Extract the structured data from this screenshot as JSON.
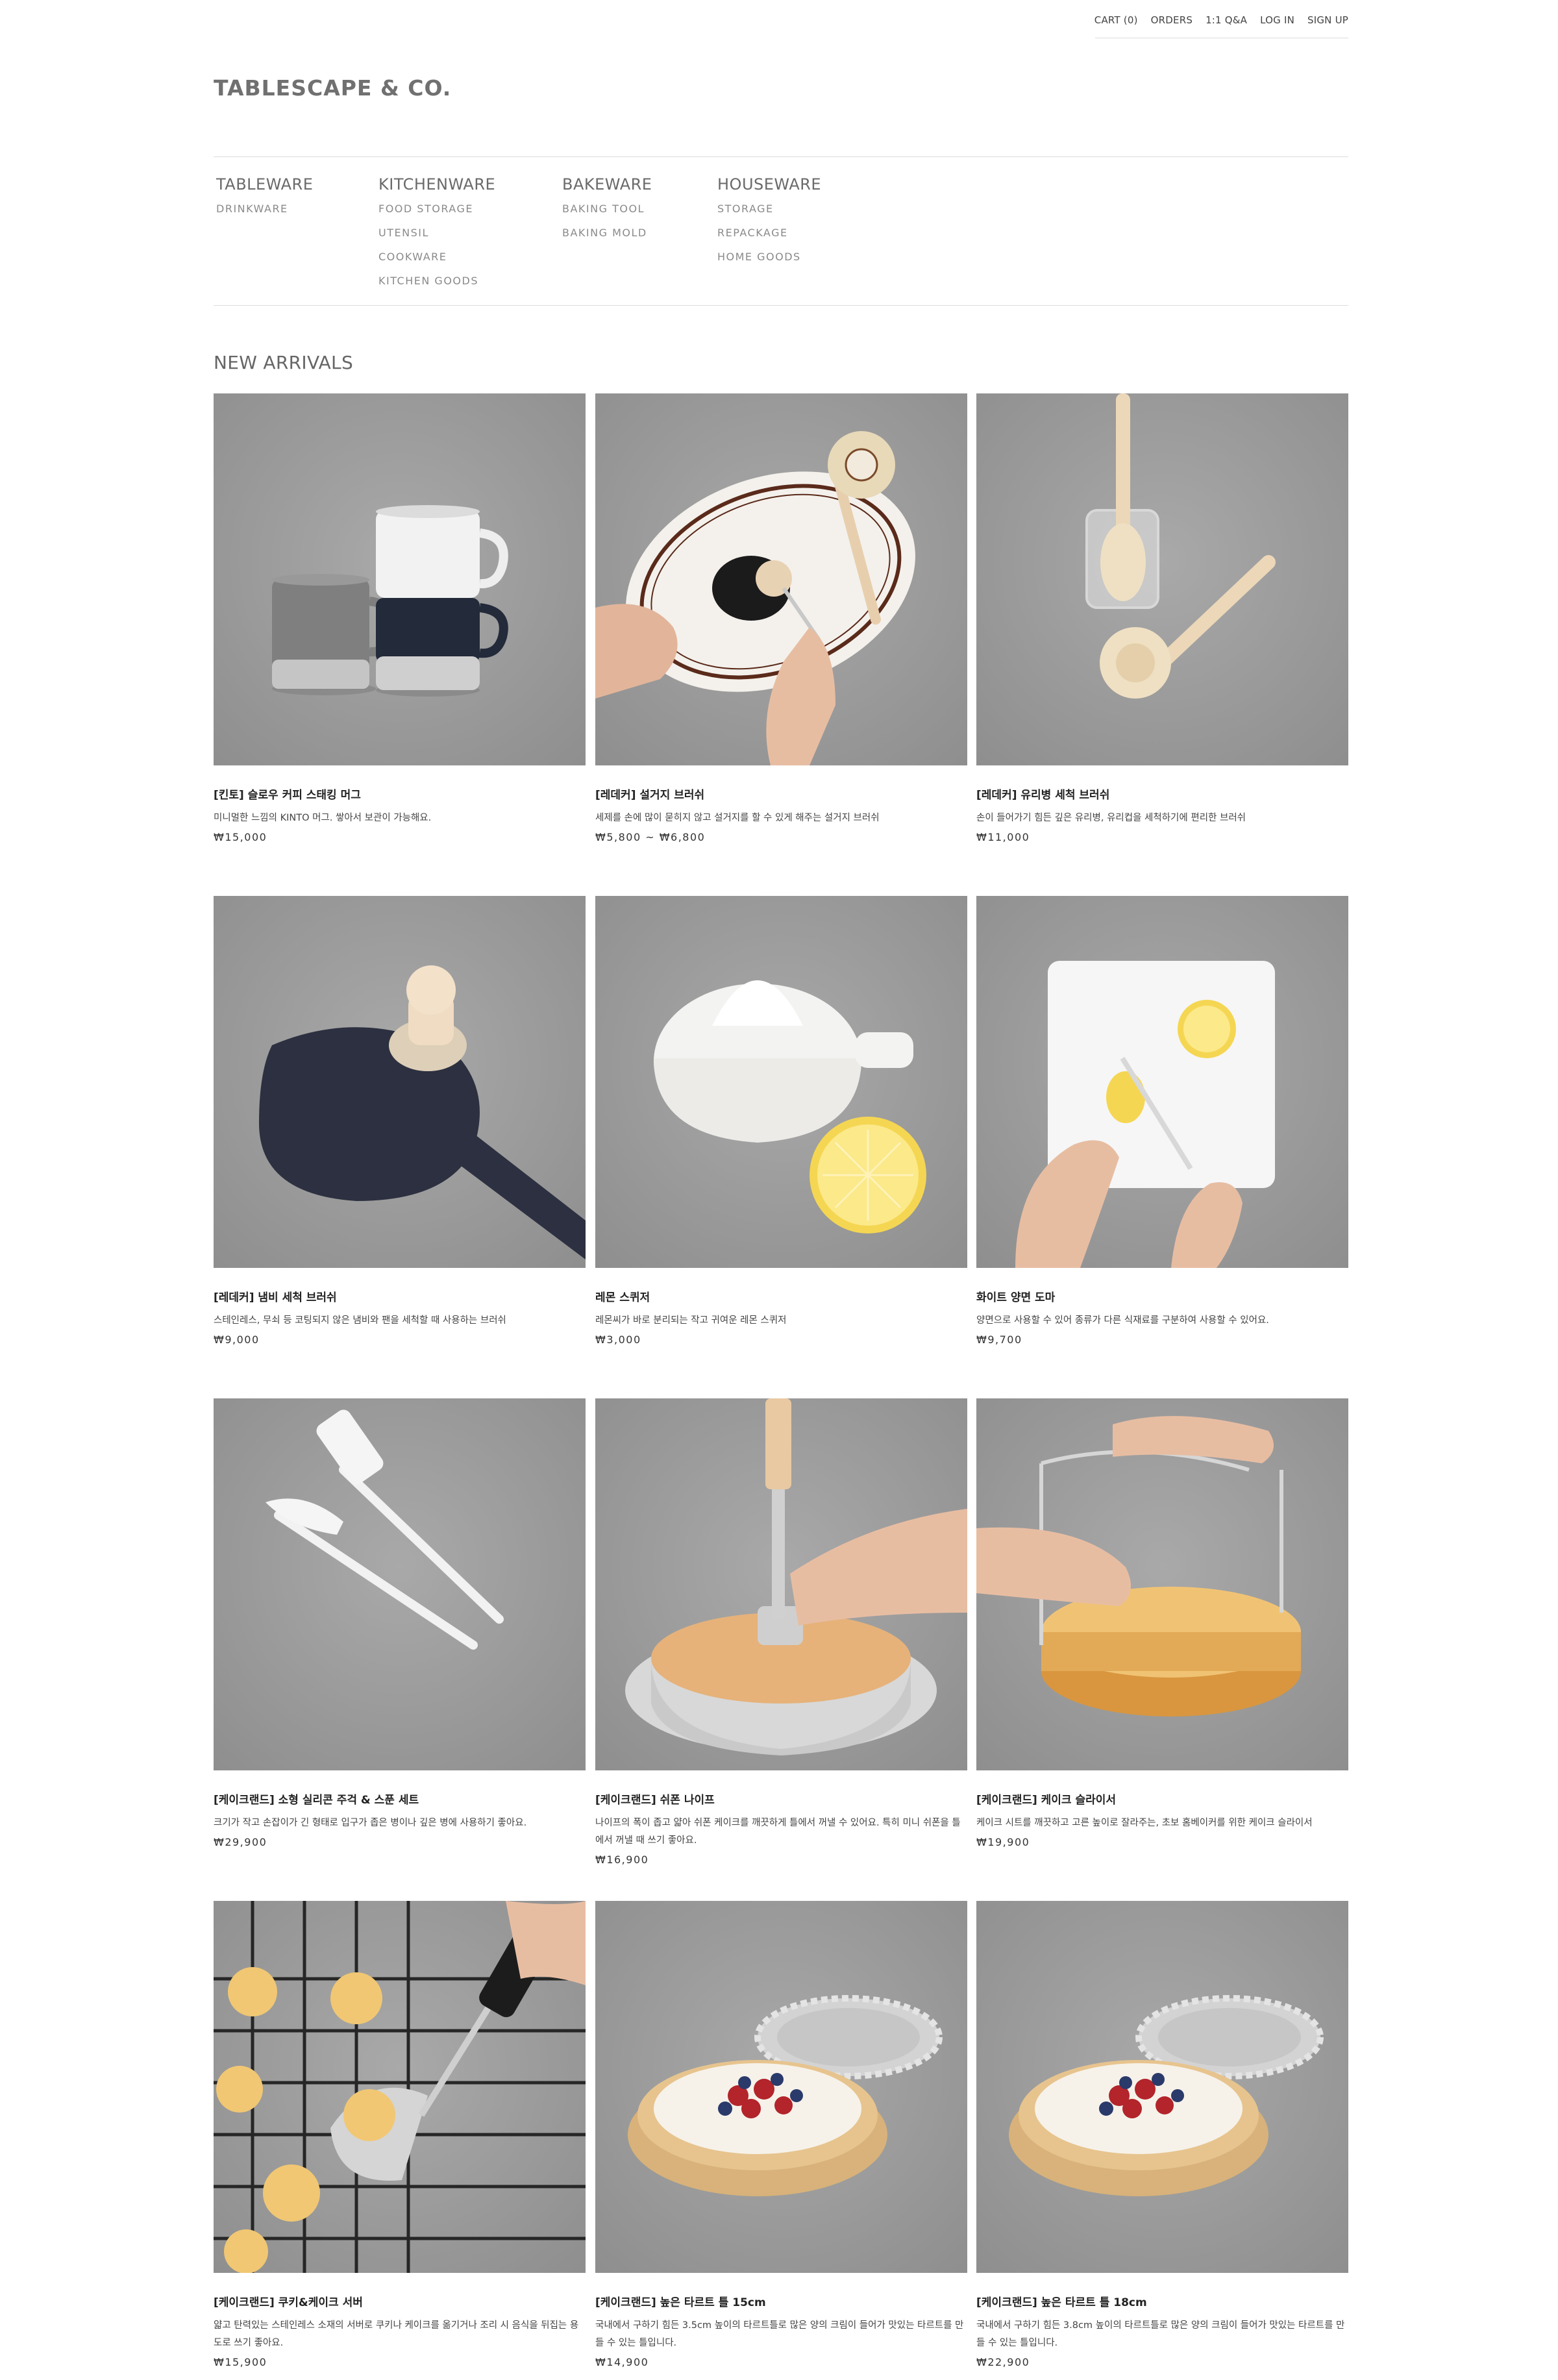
{
  "header": {
    "util_links": [
      "CART (0)",
      "ORDERS",
      "1:1 Q&A",
      "LOG IN",
      "SIGN UP"
    ],
    "logo": "TABLESCAPE & CO."
  },
  "nav": [
    {
      "label": "TABLEWARE",
      "subs": [
        "DRINKWARE"
      ]
    },
    {
      "label": "KITCHENWARE",
      "subs": [
        "FOOD STORAGE",
        "UTENSIL",
        "COOKWARE",
        "KITCHEN GOODS"
      ]
    },
    {
      "label": "BAKEWARE",
      "subs": [
        "BAKING TOOL",
        "BAKING MOLD"
      ]
    },
    {
      "label": "HOUSEWARE",
      "subs": [
        "STORAGE",
        "REPACKAGE",
        "HOME GOODS"
      ]
    }
  ],
  "section_title": "NEW ARRIVALS",
  "products": [
    {
      "name": "[킨토] 슬로우 커피 스태킹 머그",
      "desc": "미니멀한 느낌의 KINTO 머그. 쌓아서 보관이 가능해요.",
      "price": "₩15,000",
      "icon": "mugs"
    },
    {
      "name": "[레데커] 설거지 브러쉬",
      "desc": "세제를 손에 많이 묻히지 않고 설거지를 할 수 있게 해주는 설거지 브러쉬",
      "price": "₩5,800 ~ ₩6,800",
      "icon": "dish-brush"
    },
    {
      "name": "[레데커] 유리병 세척 브러쉬",
      "desc": "손이 들어가기 힘든 깊은 유리병, 유리컵을 세척하기에 편리한 브러쉬",
      "price": "₩11,000",
      "icon": "bottle-brush"
    },
    {
      "name": "[레데커] 냄비 세척 브러쉬",
      "desc": "스테인레스, 무쇠 등 코팅되지 않은 냄비와 팬을 세척할 때 사용하는 브러쉬",
      "price": "₩9,000",
      "icon": "pot-brush"
    },
    {
      "name": "레몬 스퀴저",
      "desc": "레몬씨가 바로 분리되는 작고 귀여운 레몬 스퀴저",
      "price": "₩3,000",
      "icon": "lemon-squeezer"
    },
    {
      "name": "화이트 양면 도마",
      "desc": "양면으로 사용할 수 있어 종류가 다른 식재료를 구분하여 사용할 수 있어요.",
      "price": "₩9,700",
      "icon": "cutting-board"
    },
    {
      "name": "[케이크랜드] 소형 실리콘 주걱 & 스푼 세트",
      "desc": "크기가 작고 손잡이가 긴 형태로 입구가 좁은 병이나 깊은 병에 사용하기 좋아요.",
      "price": "₩29,900",
      "icon": "spatulas"
    },
    {
      "name": "[케이크랜드] 쉬폰 나이프",
      "desc": "나이프의 폭이 좁고 얇아 쉬폰 케이크를 깨끗하게 틀에서 꺼낼 수 있어요. 특히 미니 쉬폰을 틀에서 꺼낼 때 쓰기 좋아요.",
      "price": "₩16,900",
      "icon": "chiffon-knife"
    },
    {
      "name": "[케이크랜드] 케이크 슬라이서",
      "desc": "케이크 시트를 깨끗하고 고른 높이로 잘라주는, 초보 홈베이커를 위한 케이크 슬라이서",
      "price": "₩19,900",
      "icon": "cake-slicer"
    },
    {
      "name": "[케이크랜드] 쿠키&케이크 서버",
      "desc": "얇고 탄력있는 스테인레스 소재의 서버로 쿠키나 케이크를 옮기거나 조리 시 음식을 뒤집는 용도로 쓰기 좋아요.",
      "price": "₩15,900",
      "icon": "cookie-server"
    },
    {
      "name": "[케이크랜드] 높은 타르트 틀 15cm",
      "desc": "국내에서 구하기 힘든 3.5cm 높이의 타르트틀로 많은 양의 크림이 들어가 맛있는 타르트를 만들 수 있는 틀입니다.",
      "price": "₩14,900",
      "icon": "tart-mold"
    },
    {
      "name": "[케이크랜드] 높은 타르트 틀 18cm",
      "desc": "국내에서 구하기 힘든 3.8cm 높이의 타르트틀로 많은 양의 크림이 들어가 맛있는 타르트를 만들 수 있는 틀입니다.",
      "price": "₩22,900",
      "icon": "tart-mold"
    }
  ]
}
